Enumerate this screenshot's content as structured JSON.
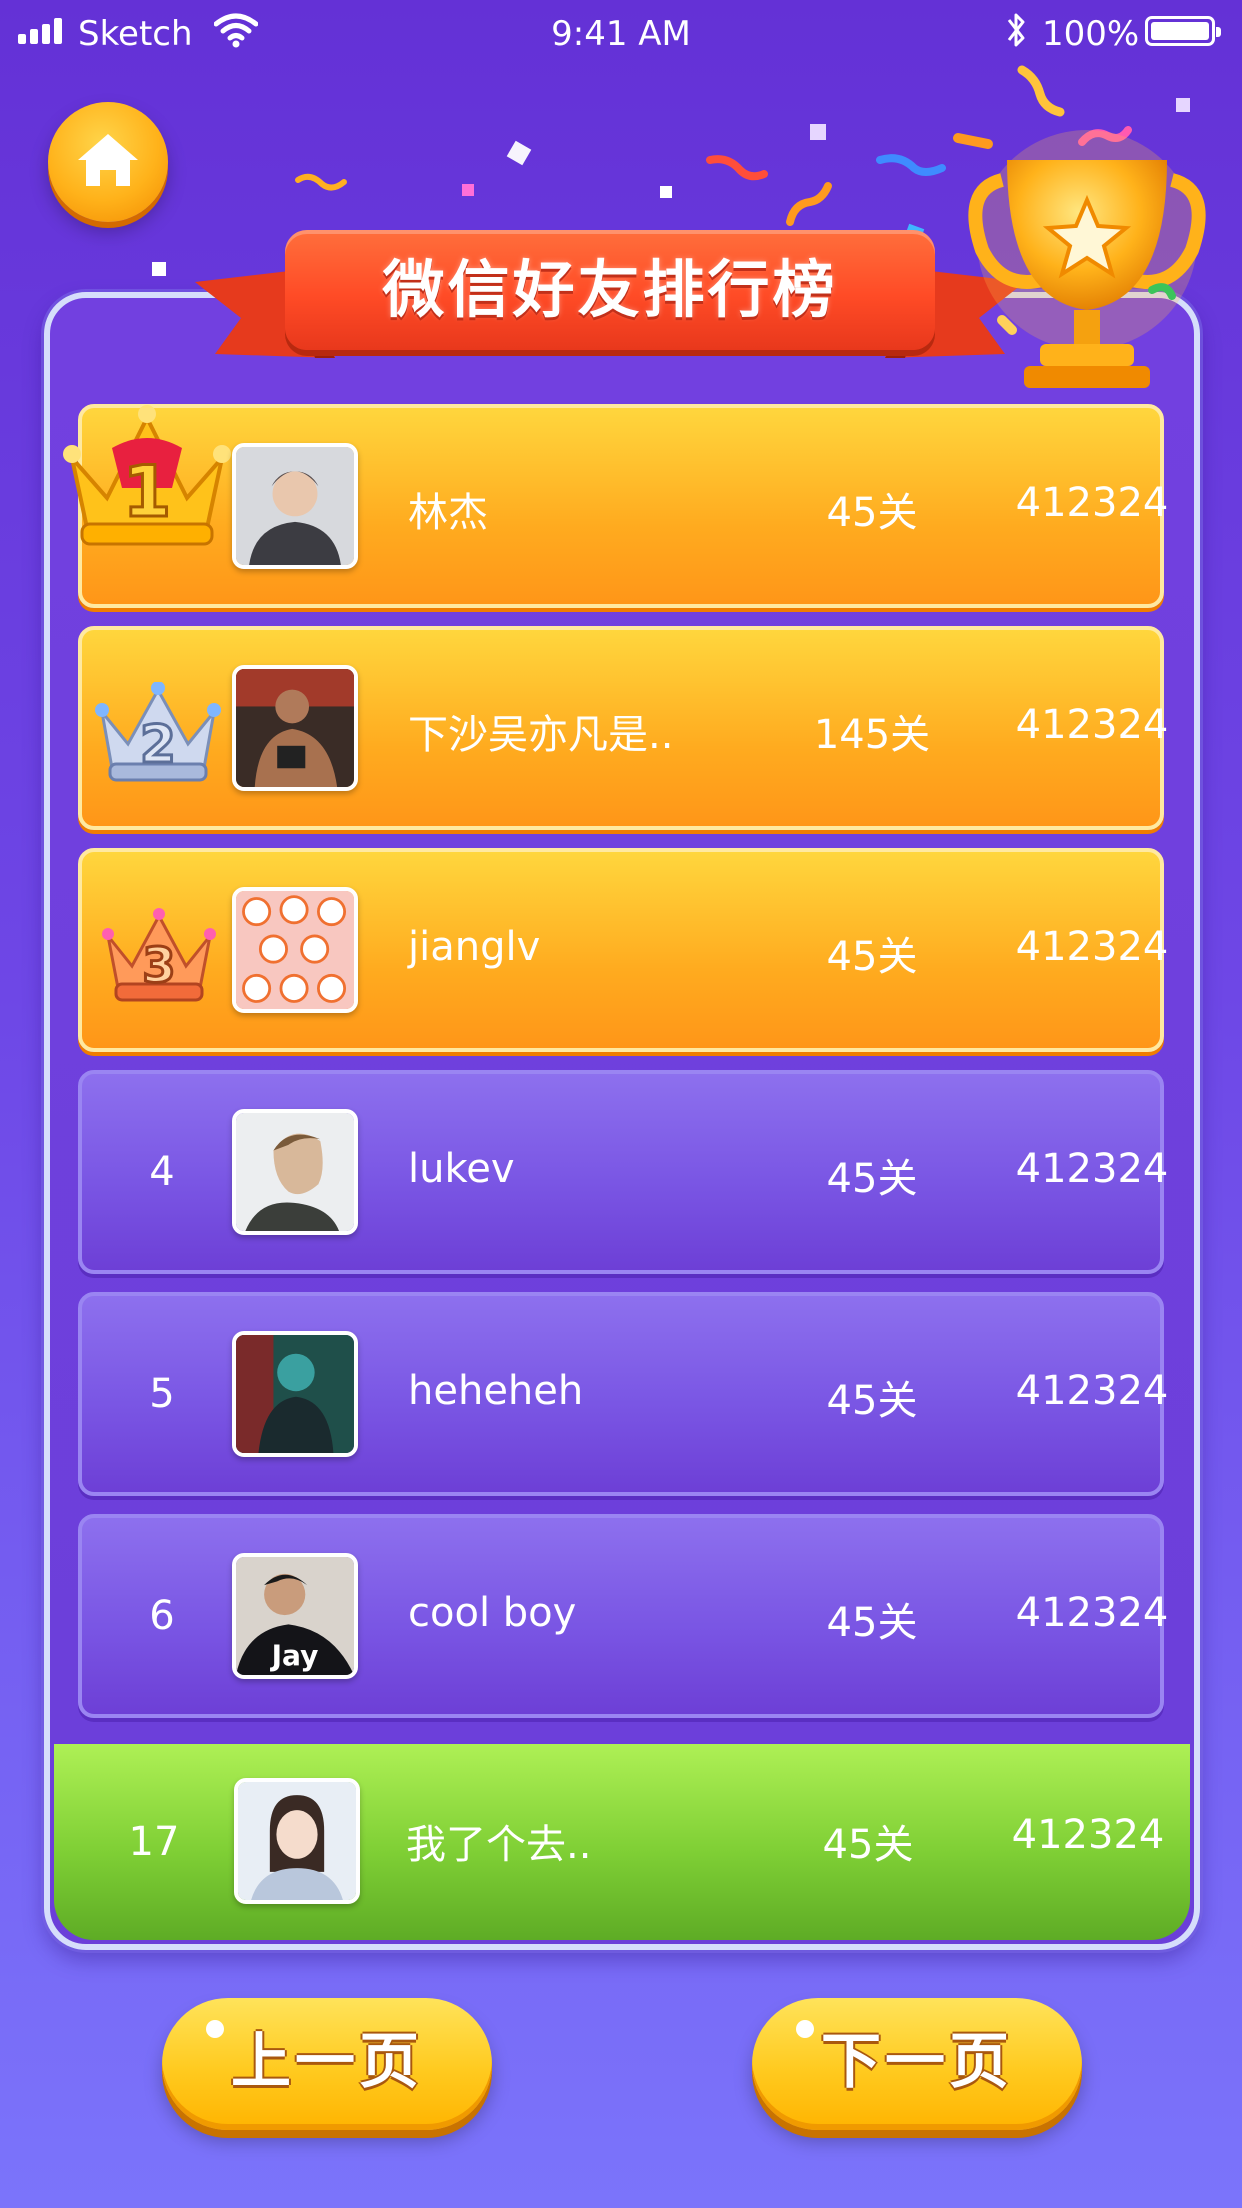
{
  "status_bar": {
    "carrier": "Sketch",
    "time": "9:41 AM",
    "battery": "100%"
  },
  "leaderboard": {
    "title": "微信好友排行榜",
    "rows": [
      {
        "rank": "1",
        "name": "林杰",
        "level": "45关",
        "score": "412324"
      },
      {
        "rank": "2",
        "name": "下沙吴亦凡是..",
        "level": "145关",
        "score": "412324"
      },
      {
        "rank": "3",
        "name": "jianglv",
        "level": "45关",
        "score": "412324"
      },
      {
        "rank": "4",
        "name": "lukev",
        "level": "45关",
        "score": "412324"
      },
      {
        "rank": "5",
        "name": "heheheh",
        "level": "45关",
        "score": "412324"
      },
      {
        "rank": "6",
        "name": "cool boy",
        "level": "45关",
        "score": "412324"
      }
    ],
    "self_row": {
      "rank": "17",
      "name": "我了个去..",
      "level": "45关",
      "score": "412324"
    }
  },
  "avatar_6_text": "Jay",
  "pagination": {
    "prev_label": "上一页",
    "next_label": "下一页"
  },
  "colors": {
    "background_top": "#6431d6",
    "background_bottom": "#7b74fb",
    "gold_row": "#ffab1f",
    "purple_row": "#7a56e4",
    "self_row": "#7fcf35",
    "ribbon": "#ff4b26",
    "button": "#ffca1f"
  },
  "icons": {
    "home_button": "home-icon",
    "trophy": "trophy-icon",
    "rank_1": "gold-crown-icon",
    "rank_2": "silver-crown-icon",
    "rank_3": "bronze-crown-icon"
  }
}
